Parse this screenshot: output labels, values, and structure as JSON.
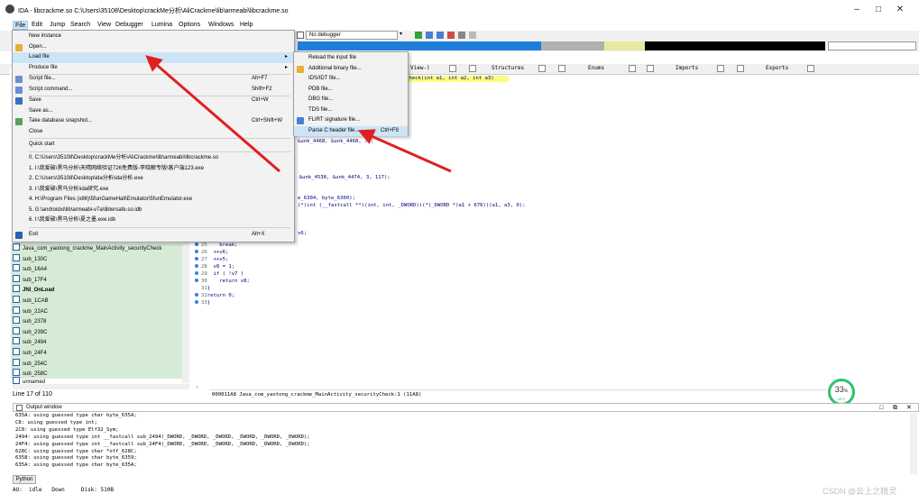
{
  "window": {
    "title": "IDA - libcrackme.so C:\\Users\\35108\\Desktop\\crackMe分析\\AliCrackme\\lib\\armeabi\\libcrackme.so",
    "minimize": "–",
    "maximize": "□",
    "close": "✕"
  },
  "menubar": [
    "File",
    "Edit",
    "Jump",
    "Search",
    "View",
    "Debugger",
    "Lumina",
    "Options",
    "Windows",
    "Help"
  ],
  "toolbar": {
    "debugger_select": "No debugger"
  },
  "file_menu": {
    "items": [
      {
        "label": "New instance",
        "shortcut": ""
      },
      {
        "label": "Open...",
        "shortcut": ""
      },
      {
        "label": "Load file",
        "shortcut": "",
        "submenu": true
      },
      {
        "label": "Produce file",
        "shortcut": "",
        "submenu": true
      },
      {
        "label": "Script file...",
        "shortcut": "Alt+F7"
      },
      {
        "label": "Script command...",
        "shortcut": "Shift+F2"
      },
      {
        "label": "Save",
        "shortcut": "Ctrl+W"
      },
      {
        "label": "Save as...",
        "shortcut": ""
      },
      {
        "label": "Take database snapshot...",
        "shortcut": "Ctrl+Shift+W"
      },
      {
        "label": "Close",
        "shortcut": ""
      },
      {
        "label": "Quick start",
        "shortcut": ""
      }
    ],
    "recent": [
      "0. C:\\Users\\35108\\Desktop\\crackMe分析\\AliCrackme\\lib\\armeabi\\libcrackme.so",
      "1. I:\\我爱破\\黑马分析\\天晴网络验证726免费版-李晓解专版\\客户端123.exe",
      "2. C:\\Users\\35108\\Desktop\\ida分析\\ida分析.exe",
      "3. I:\\我爱破\\黑马分析\\ida研究.exe",
      "4. H:\\Program Files (x86)\\5funGameHall\\Emulator\\5funEmulator.exe",
      "5. G:\\androidxi\\lib\\armeabi-v7a\\libtersafe.so.idb",
      "6. I:\\我爱破\\黑马分析\\夏之墨.exe.idb"
    ],
    "exit": {
      "label": "Exit",
      "shortcut": "Alt+X"
    }
  },
  "load_submenu": [
    {
      "label": "Reload the input file",
      "shortcut": ""
    },
    {
      "label": "Additional binary file...",
      "shortcut": ""
    },
    {
      "label": "IDS/IDT file...",
      "shortcut": ""
    },
    {
      "label": "PDB file...",
      "shortcut": ""
    },
    {
      "label": "DBG file...",
      "shortcut": ""
    },
    {
      "label": "TDS file...",
      "shortcut": ""
    },
    {
      "label": "FLIRT signature file...",
      "shortcut": ""
    },
    {
      "label": "Parse C header file...",
      "shortcut": "Ctrl+F9"
    }
  ],
  "tabs": [
    "View-)",
    "Structures",
    "Enums",
    "Imports",
    "Exports"
  ],
  "functions": [
    "Java_com_yaotong_crackme_MainActivity_securityCheck",
    "sub_130C",
    "sub_16A4",
    "sub_17F4",
    "JNI_OnLoad",
    "sub_1CAB",
    "sub_22AC",
    "sub_2378",
    "sub_239C",
    "sub_2494",
    "sub_24F4",
    "sub_254C",
    "sub_258C",
    "unnamed"
  ],
  "line_status": "Line 17 of 110",
  "code": {
    "header_line": "Check(int a1, int a2, int a3)",
    "snippets": [
      "&unk_4468, &unk_4468, 7);",
      ", &unk_4538, &unk_4474, 3, 117);",
      "e_6304, byte_6360);",
      "(*(int (__fastcall **)(int, int, _DWORD))(*(_DWORD *)a1 + 676))(a1, a3, 0);",
      "v6;"
    ],
    "lines": [
      {
        "n": "25",
        "t": "    break;"
      },
      {
        "n": "26",
        "t": "  ++v6;"
      },
      {
        "n": "27",
        "t": "  ++v5;"
      },
      {
        "n": "28",
        "t": "  v8 = 1;"
      },
      {
        "n": "29",
        "t": "  if ( !v7 )"
      },
      {
        "n": "30",
        "t": "    return v8;"
      },
      {
        "n": "31",
        "t": "}"
      },
      {
        "n": "32",
        "t": "return 0;"
      },
      {
        "n": "33",
        "t": "}"
      }
    ],
    "status": "000011A8 Java_com_yaotong_crackme_MainActivity_securityCheck:1 (11A8)"
  },
  "progress": {
    "percent": "33",
    "unit": "%",
    "sub": "49°C"
  },
  "output": {
    "title": "Output window",
    "lines": [
      "635A: using guessed type char byte_635A;",
      "C8: using guessed type int;",
      "2C8: using guessed type Elf32_Sym;",
      "2494: using guessed type int __fastcall sub_2494(_DWORD, _DWORD, _DWORD, _DWORD, _DWORD, _DWORD);",
      "24F4: using guessed type int __fastcall sub_24F4(_DWORD, _DWORD, _DWORD, _DWORD, _DWORD, _DWORD);",
      "628C: using guessed type char *off_628C;",
      "6358: using guessed type char byte_6359;",
      "635A: using guessed type char byte_635A;"
    ],
    "tab": "Python"
  },
  "bottom_status": "AU:  idle   Down     Disk: 510B",
  "watermark": "CSDN @云上之精灵",
  "colors": {
    "arrow": "#e02020",
    "funclist_bg": "#d6ebd6",
    "highlight": "#fcfc80",
    "progress": "#2fc26e"
  }
}
